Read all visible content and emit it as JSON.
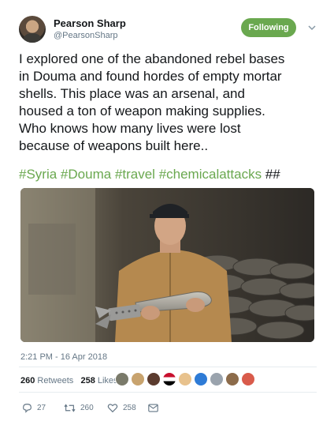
{
  "user": {
    "name": "Pearson Sharp",
    "handle": "@PearsonSharp",
    "follow_label": "Following",
    "follow_color": "#6aa84f"
  },
  "tweet": {
    "lines": [
      "I explored one of the abandoned rebel bases",
      "in Douma and found hordes of empty mortar",
      "shells. This place was an arsenal, and",
      "housed a ton of weapon making supplies.",
      "Who knows how many lives were lost",
      "because of weapons built here.."
    ],
    "hashtags": [
      "#Syria",
      "#Douma",
      "#travel",
      "#chemicalattacks"
    ],
    "trailing": "##"
  },
  "meta": {
    "timestamp": "2:21 PM - 16 Apr 2018"
  },
  "stats": {
    "retweets_count": "260",
    "retweets_label": "Retweets",
    "likes_count": "258",
    "likes_label": "Likes"
  },
  "actions": {
    "reply_count": "27",
    "retweet_count": "260",
    "like_count": "258"
  },
  "icons": {
    "reply": "reply-icon",
    "retweet": "retweet-icon",
    "like": "heart-icon",
    "dm": "envelope-icon",
    "caret": "chevron-down-icon"
  }
}
